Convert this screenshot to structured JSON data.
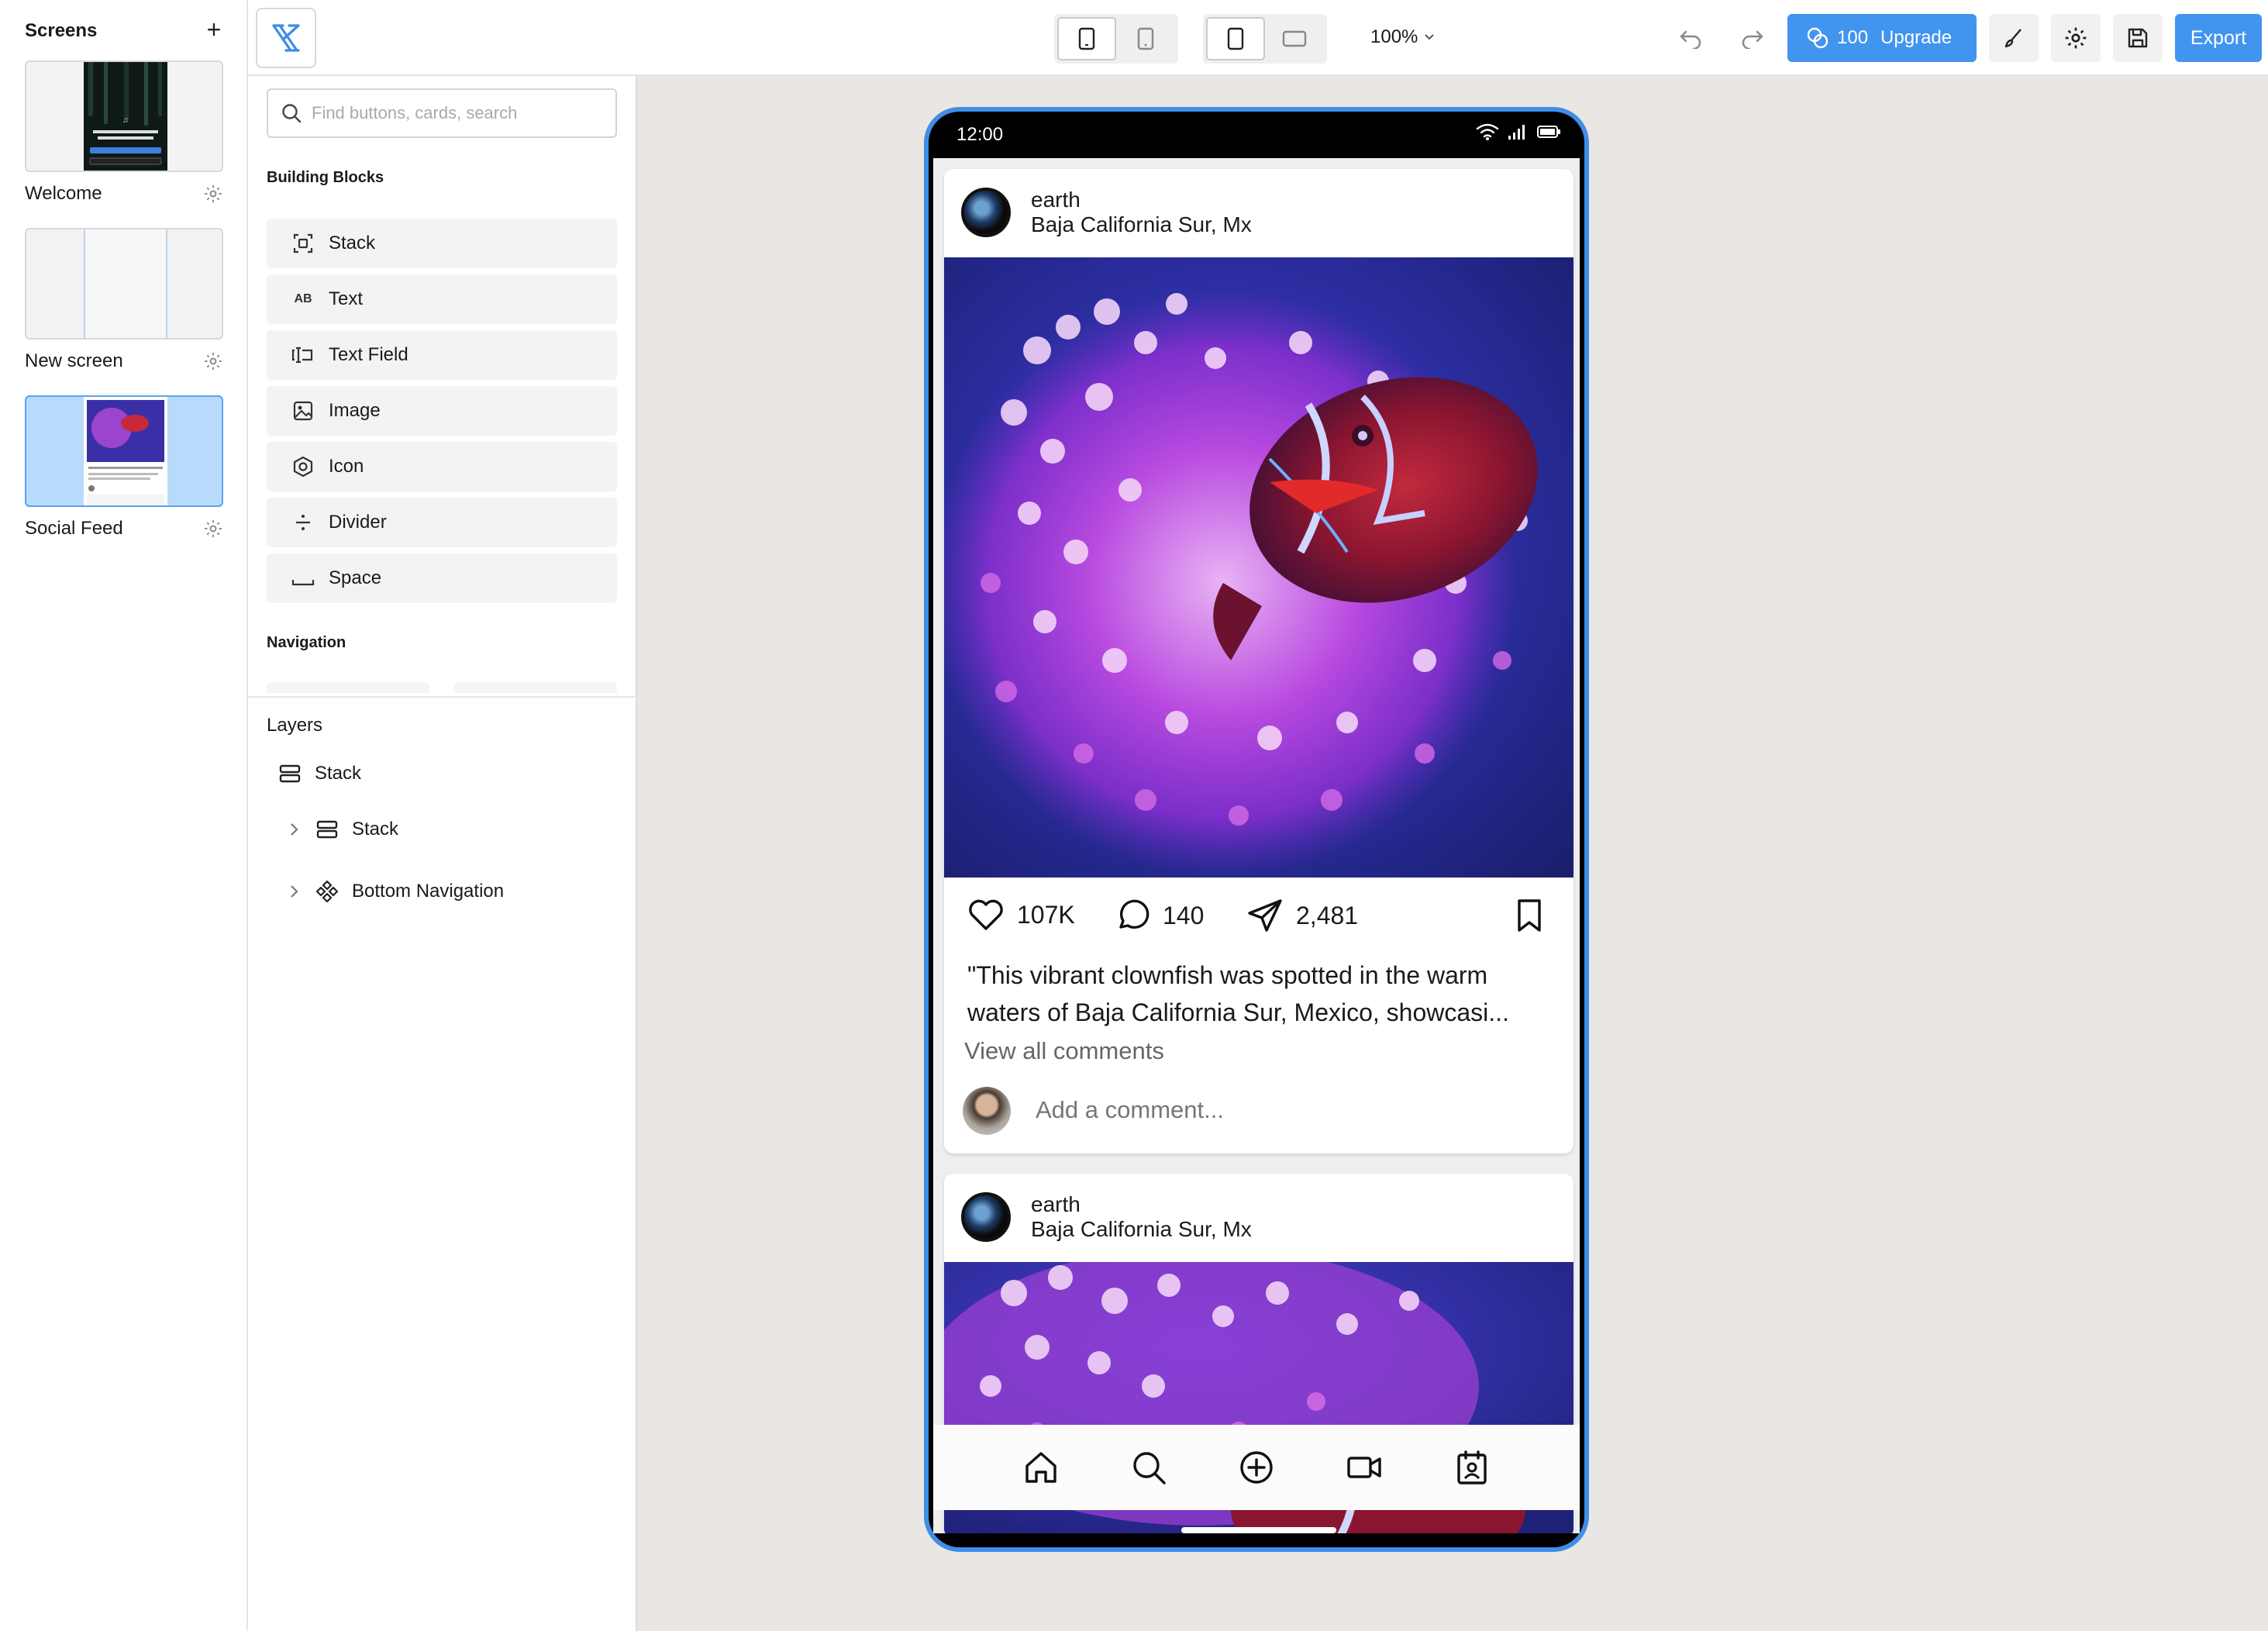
{
  "screens_panel": {
    "title": "Screens",
    "add_label": "+",
    "screens": [
      {
        "label": "Welcome"
      },
      {
        "label": "New screen"
      },
      {
        "label": "Social Feed",
        "active": true
      }
    ]
  },
  "components": {
    "search_placeholder": "Find buttons, cards, search",
    "building_blocks_title": "Building Blocks",
    "blocks": [
      {
        "label": "Stack",
        "icon": "stack-frame-icon"
      },
      {
        "label": "Text",
        "icon": "text-ab-icon",
        "glyph": "AB"
      },
      {
        "label": "Text Field",
        "icon": "text-field-icon"
      },
      {
        "label": "Image",
        "icon": "image-icon"
      },
      {
        "label": "Icon",
        "icon": "hexagon-icon"
      },
      {
        "label": "Divider",
        "icon": "divider-icon"
      },
      {
        "label": "Space",
        "icon": "space-icon"
      }
    ],
    "navigation_title": "Navigation",
    "layers_title": "Layers",
    "layers": [
      {
        "label": "Stack",
        "icon": "stack-icon"
      },
      {
        "label": "Stack",
        "icon": "stack-icon",
        "expandable": true
      },
      {
        "label": "Bottom Navigation",
        "icon": "component-icon",
        "expandable": true
      }
    ]
  },
  "toolbar": {
    "zoom": "100%",
    "credits": "100",
    "upgrade_label": "Upgrade",
    "export_label": "Export"
  },
  "phone": {
    "status_time": "12:00",
    "posts": [
      {
        "user": "earth",
        "location": "Baja California Sur, Mx",
        "likes": "107K",
        "comments": "140",
        "shares": "2,481",
        "caption": "\"This vibrant clownfish was spotted in the warm waters of Baja California Sur, Mexico, showcasi...",
        "view_comments": "View all comments",
        "comment_placeholder": "Add a comment..."
      },
      {
        "user": "earth",
        "location": "Baja California Sur, Mx"
      }
    ],
    "bottom_nav": [
      "home-icon",
      "search-icon",
      "add-circle-icon",
      "video-icon",
      "contact-icon"
    ]
  },
  "colors": {
    "accent": "#4295ef",
    "phone_border": "#3f8ee8",
    "active_screen": "#b9dbfb",
    "canvas": "#e9e6e3"
  }
}
